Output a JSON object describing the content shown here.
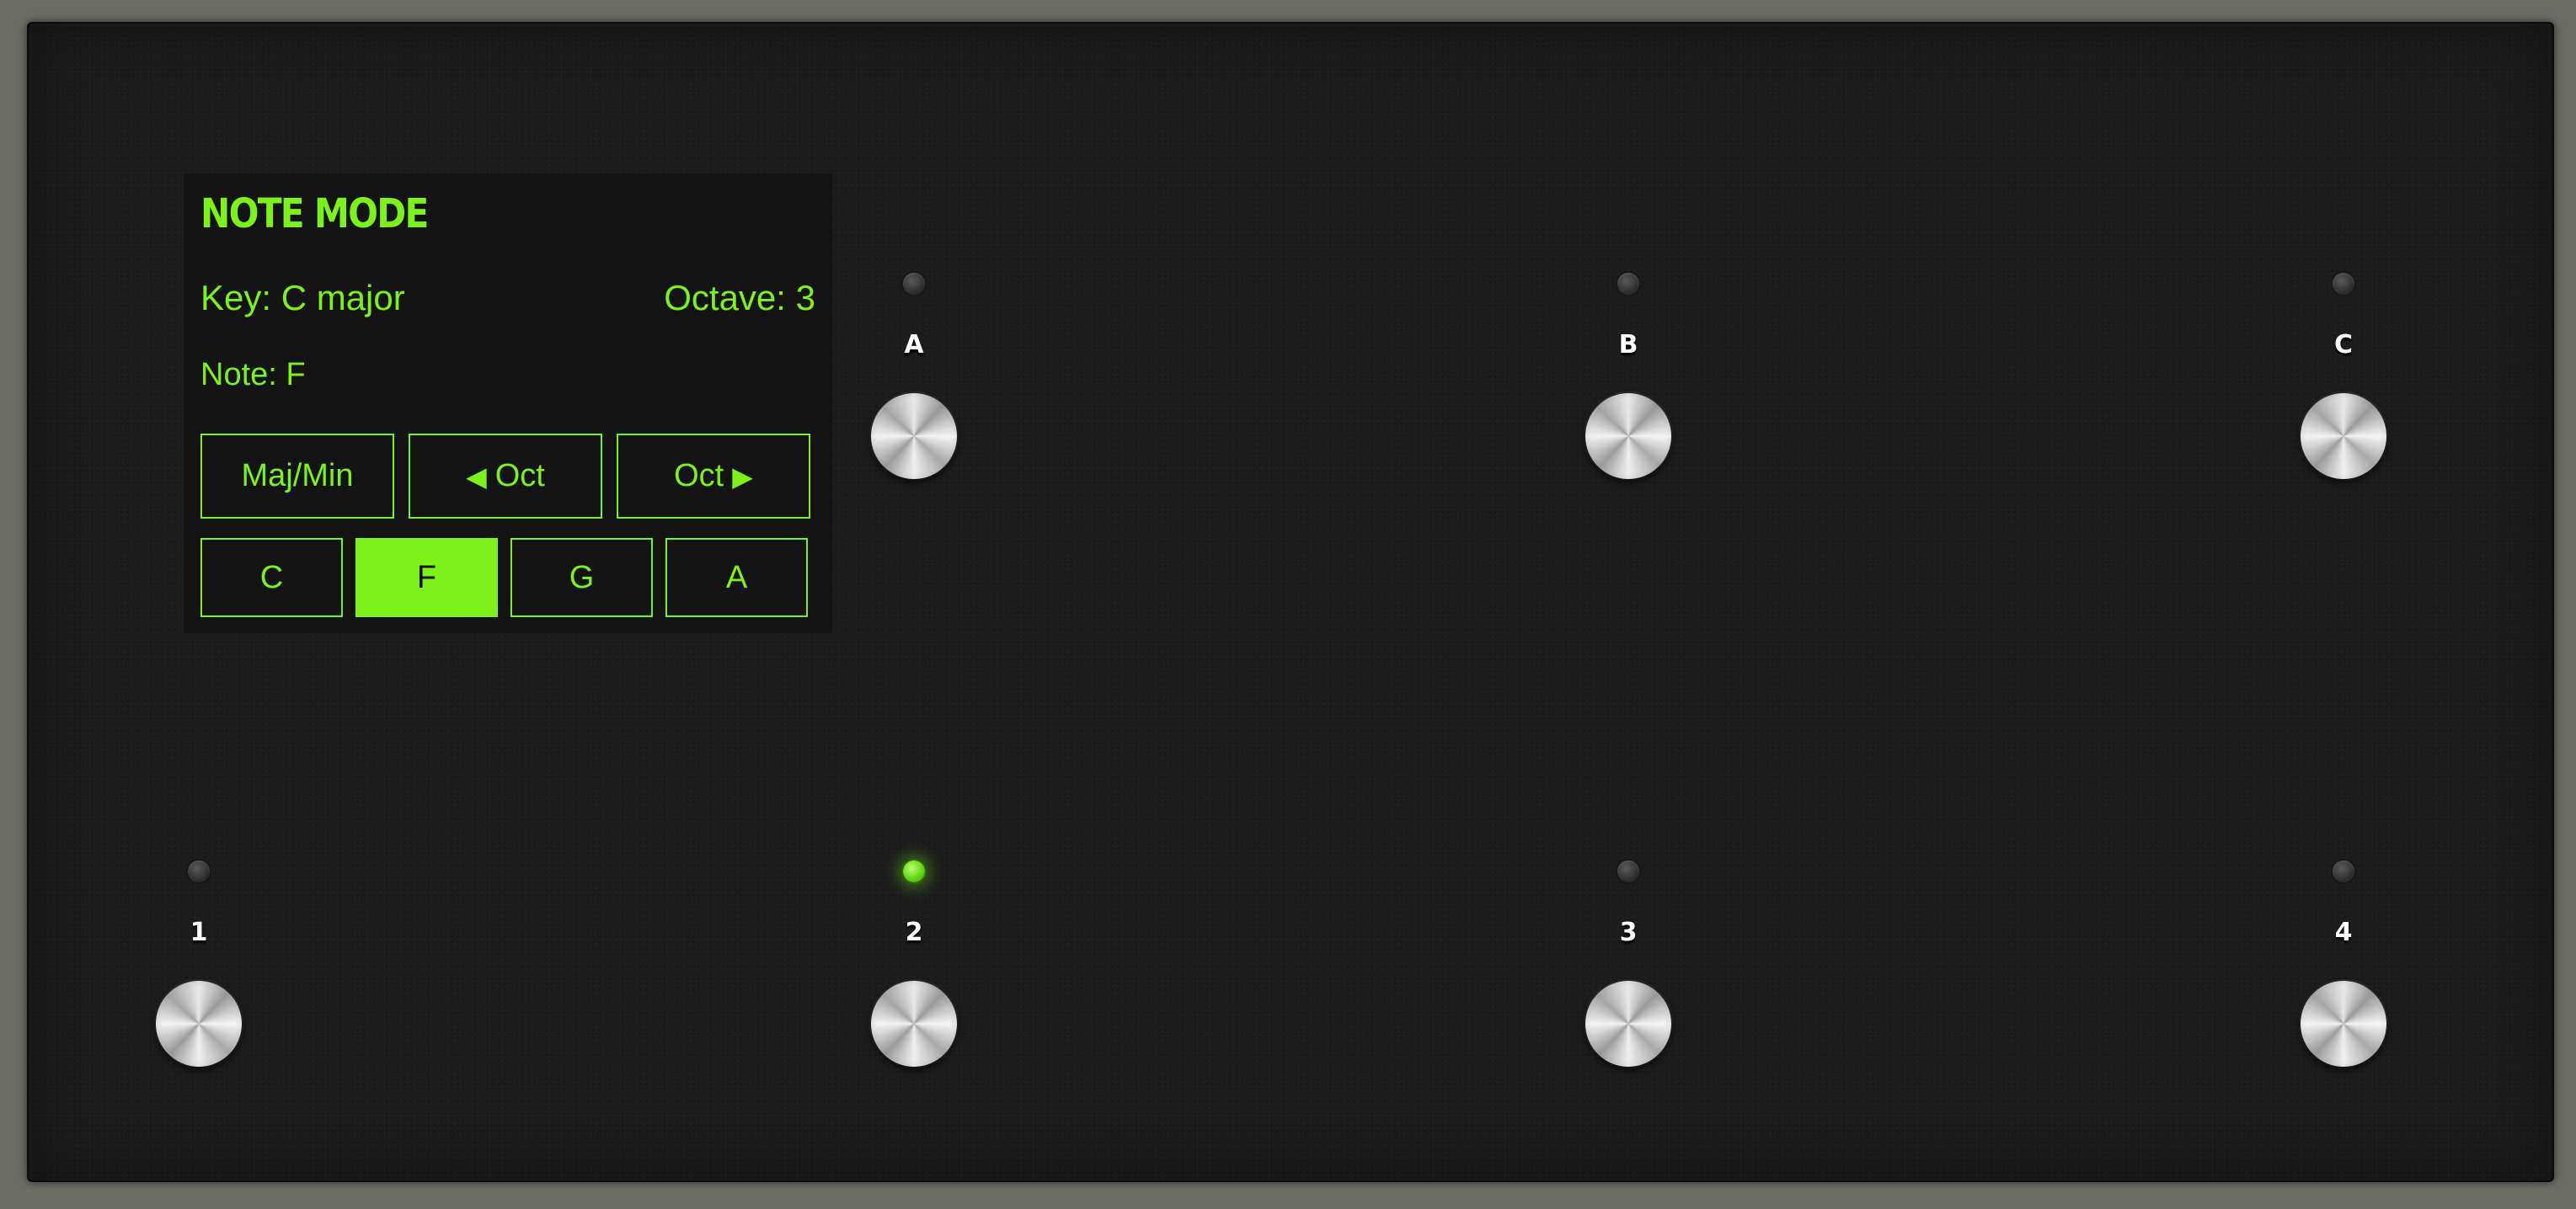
{
  "display": {
    "title": "NOTE MODE",
    "key": "Key: C major",
    "octave": "Octave: 3",
    "note": "Note: F",
    "buttons_row1": [
      {
        "label": "Maj/Min",
        "prefix_icon": "",
        "suffix_icon": ""
      },
      {
        "label": "Oct",
        "prefix_icon": "◀",
        "suffix_icon": ""
      },
      {
        "label": "Oct",
        "prefix_icon": "",
        "suffix_icon": "▶"
      }
    ],
    "note_buttons": [
      {
        "label": "C",
        "active": false
      },
      {
        "label": "F",
        "active": true
      },
      {
        "label": "G",
        "active": false
      },
      {
        "label": "A",
        "active": false
      }
    ],
    "accent_color": "#7cf21a"
  },
  "switches": {
    "top": [
      {
        "label": "A",
        "led_on": false
      },
      {
        "label": "B",
        "led_on": false
      },
      {
        "label": "C",
        "led_on": false
      }
    ],
    "bottom": [
      {
        "label": "1",
        "led_on": false
      },
      {
        "label": "2",
        "led_on": true
      },
      {
        "label": "3",
        "led_on": false
      },
      {
        "label": "4",
        "led_on": false
      }
    ]
  }
}
